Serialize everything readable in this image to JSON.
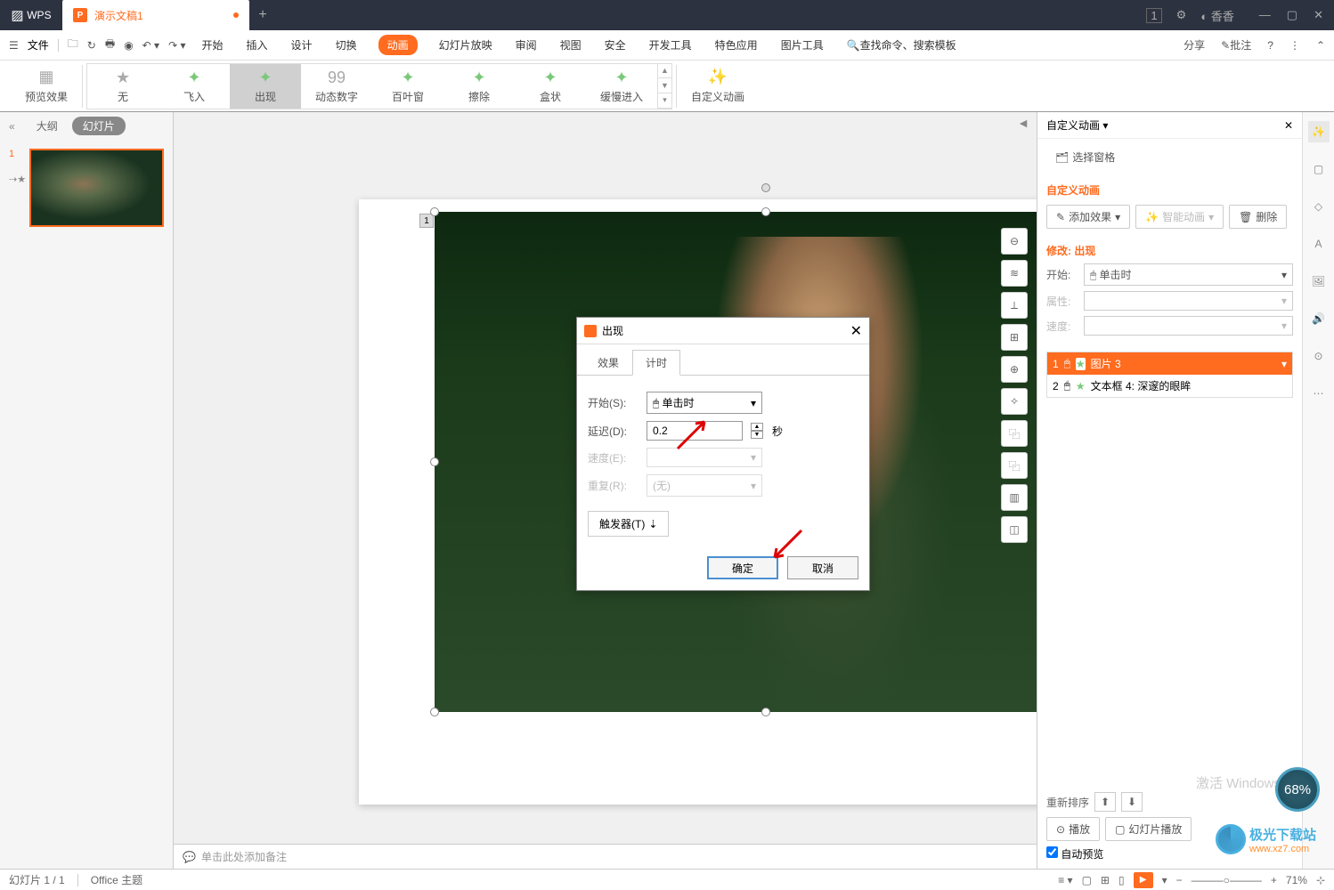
{
  "titlebar": {
    "app": "WPS",
    "doc": "演示文稿1",
    "count": "1",
    "user": "香香"
  },
  "menu": {
    "file": "文件",
    "tabs": [
      "开始",
      "插入",
      "设计",
      "切换",
      "动画",
      "幻灯片放映",
      "审阅",
      "视图",
      "安全",
      "开发工具",
      "特色应用",
      "图片工具"
    ],
    "search": "查找命令、搜索模板",
    "share": "分享",
    "annotate": "批注"
  },
  "ribbon": {
    "preview": "预览效果",
    "none": "无",
    "flyin": "飞入",
    "appear": "出现",
    "dynum": "动态数字",
    "blinds": "百叶窗",
    "wipe": "擦除",
    "box": "盒状",
    "slowenter": "缓慢进入",
    "custom": "自定义动画"
  },
  "leftpanel": {
    "outline": "大纲",
    "slides": "幻灯片"
  },
  "rightpanel": {
    "title": "自定义动画",
    "selectpane": "选择窗格",
    "section": "自定义动画",
    "addeffect": "添加效果",
    "smart": "智能动画",
    "delete": "删除",
    "modify": "修改: 出现",
    "start": "开始:",
    "startval": "单击时",
    "prop": "属性:",
    "speed": "速度:",
    "item1": "图片 3",
    "item2": "文本框 4: 深邃的眼眸",
    "reorder": "重新排序",
    "play": "播放",
    "slideshow": "幻灯片播放",
    "autopreview": "自动预览"
  },
  "dialog": {
    "title": "出现",
    "tab_effect": "效果",
    "tab_timing": "计时",
    "start": "开始(S):",
    "startval": "单击时",
    "delay": "延迟(D):",
    "delayval": "0.2",
    "sec": "秒",
    "speed": "速度(E):",
    "repeat": "重复(R):",
    "repeatval": "(无)",
    "trigger": "触发器(T)",
    "ok": "确定",
    "cancel": "取消"
  },
  "notes": "单击此处添加备注",
  "status": {
    "slide": "幻灯片 1 / 1",
    "theme": "Office 主题",
    "zoom": "71%"
  },
  "activate": "激活 Windows",
  "watermark": {
    "cn": "极光下载站",
    "en": "www.xz7.com"
  },
  "badge": "68%"
}
